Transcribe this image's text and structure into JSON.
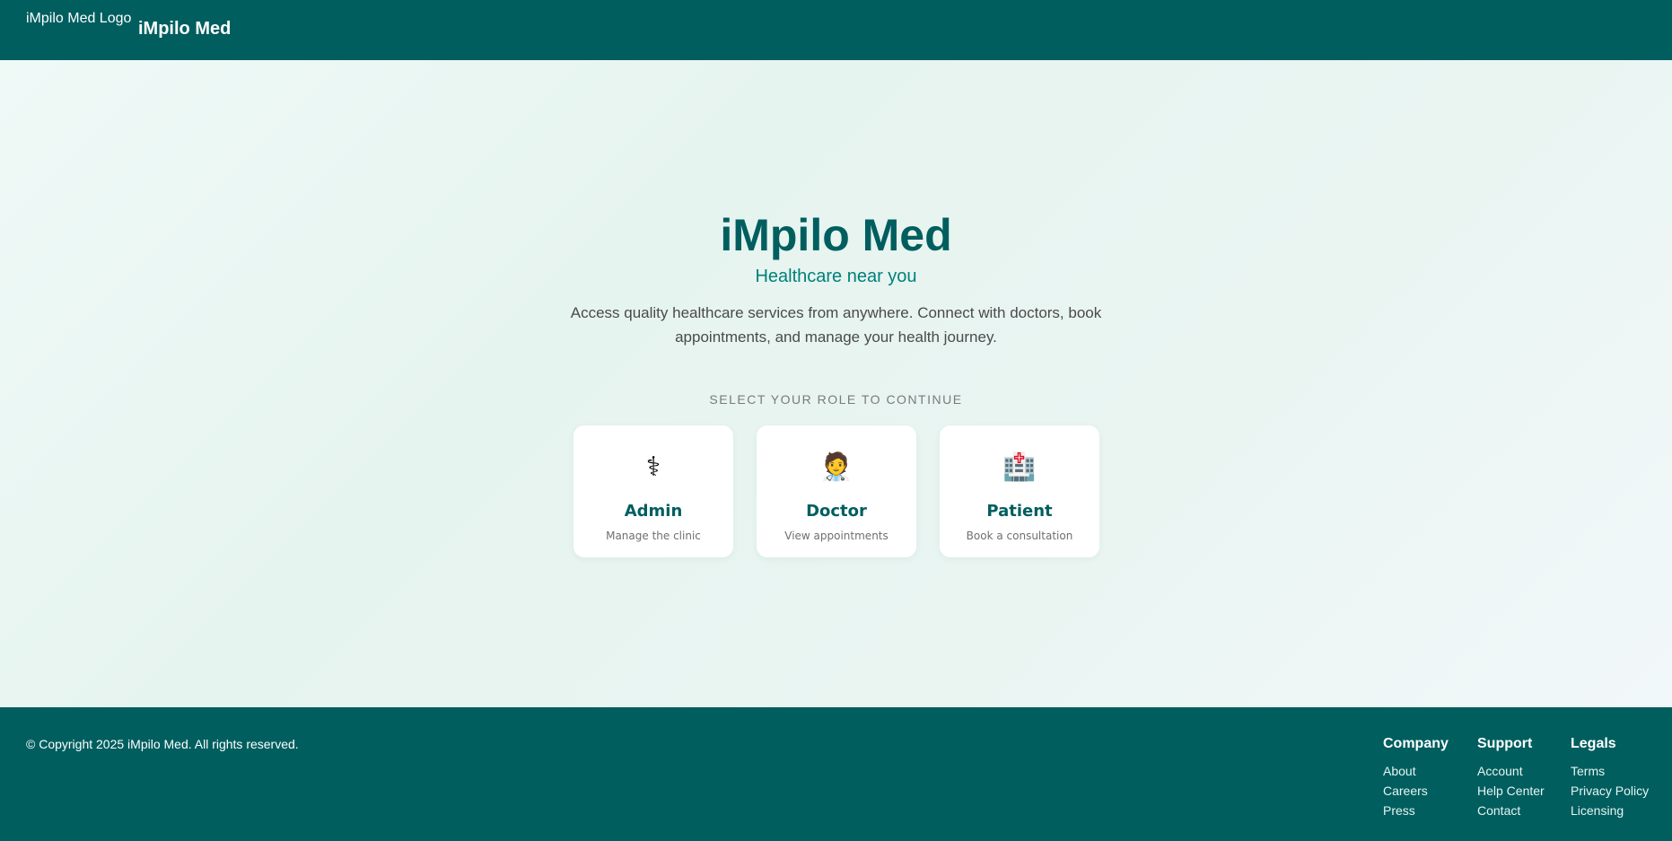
{
  "header": {
    "logo_alt": "iMpilo Med Logo",
    "brand": "iMpilo Med"
  },
  "hero": {
    "title": "iMpilo Med",
    "subtitle": "Healthcare near you",
    "description": "Access quality healthcare services from anywhere. Connect with doctors, book appointments, and manage your health journey.",
    "role_prompt": "SELECT YOUR ROLE TO CONTINUE"
  },
  "roles": [
    {
      "icon": "⚕",
      "icon_name": "caduceus-icon",
      "name": "Admin",
      "description": "Manage the clinic"
    },
    {
      "icon": "🧑‍⚕️",
      "icon_name": "doctor-icon",
      "name": "Doctor",
      "description": "View appointments"
    },
    {
      "icon": "🏥",
      "icon_name": "hospital-icon",
      "name": "Patient",
      "description": "Book a consultation"
    }
  ],
  "footer": {
    "copyright": "© Copyright 2025 iMpilo Med. All rights reserved.",
    "columns": [
      {
        "heading": "Company",
        "links": [
          "About",
          "Careers",
          "Press"
        ]
      },
      {
        "heading": "Support",
        "links": [
          "Account",
          "Help Center",
          "Contact"
        ]
      },
      {
        "heading": "Legals",
        "links": [
          "Terms",
          "Privacy Policy",
          "Licensing"
        ]
      }
    ]
  },
  "colors": {
    "primary": "#005e5f",
    "accent": "#00807a",
    "card_bg": "#ffffff"
  }
}
